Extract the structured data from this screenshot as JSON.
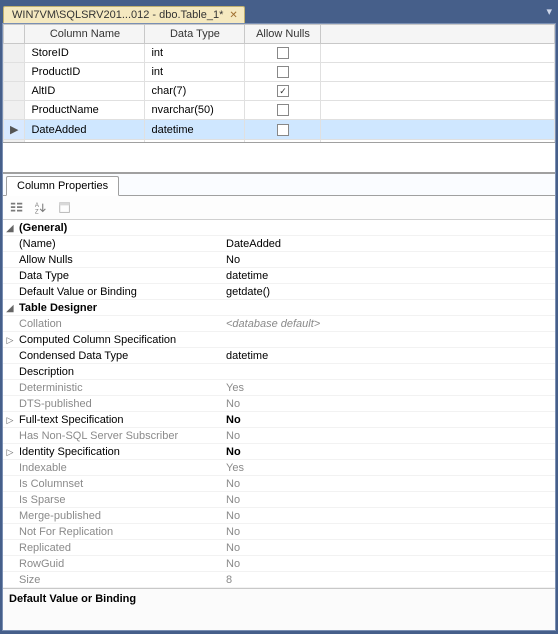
{
  "tab": {
    "title": "WIN7VM\\SQLSRV201...012 - dbo.Table_1*"
  },
  "grid": {
    "headers": {
      "name": "Column Name",
      "type": "Data Type",
      "nulls": "Allow Nulls"
    },
    "rows": [
      {
        "name": "StoreID",
        "type": "int",
        "nulls": false,
        "selected": false
      },
      {
        "name": "ProductID",
        "type": "int",
        "nulls": false,
        "selected": false
      },
      {
        "name": "AltID",
        "type": "char(7)",
        "nulls": true,
        "selected": false
      },
      {
        "name": "ProductName",
        "type": "nvarchar(50)",
        "nulls": false,
        "selected": false
      },
      {
        "name": "DateAdded",
        "type": "datetime",
        "nulls": false,
        "selected": true
      }
    ]
  },
  "props_tab": "Column Properties",
  "props": {
    "general_label": "(General)",
    "name_label": "(Name)",
    "name_value": "DateAdded",
    "allow_nulls_label": "Allow Nulls",
    "allow_nulls_value": "No",
    "data_type_label": "Data Type",
    "data_type_value": "datetime",
    "default_label": "Default Value or Binding",
    "default_value": "getdate()",
    "designer_label": "Table Designer",
    "collation_label": "Collation",
    "collation_value": "<database default>",
    "computed_label": "Computed Column Specification",
    "condensed_label": "Condensed Data Type",
    "condensed_value": "datetime",
    "description_label": "Description",
    "description_value": "",
    "deterministic_label": "Deterministic",
    "deterministic_value": "Yes",
    "dts_label": "DTS-published",
    "dts_value": "No",
    "fulltext_label": "Full-text Specification",
    "fulltext_value": "No",
    "nonsql_label": "Has Non-SQL Server Subscriber",
    "nonsql_value": "No",
    "identity_label": "Identity Specification",
    "identity_value": "No",
    "indexable_label": "Indexable",
    "indexable_value": "Yes",
    "columnset_label": "Is Columnset",
    "columnset_value": "No",
    "sparse_label": "Is Sparse",
    "sparse_value": "No",
    "merge_label": "Merge-published",
    "merge_value": "No",
    "notrepl_label": "Not For Replication",
    "notrepl_value": "No",
    "replicated_label": "Replicated",
    "replicated_value": "No",
    "rowguid_label": "RowGuid",
    "rowguid_value": "No",
    "size_label": "Size",
    "size_value": "8"
  },
  "description_pane": "Default Value or Binding"
}
